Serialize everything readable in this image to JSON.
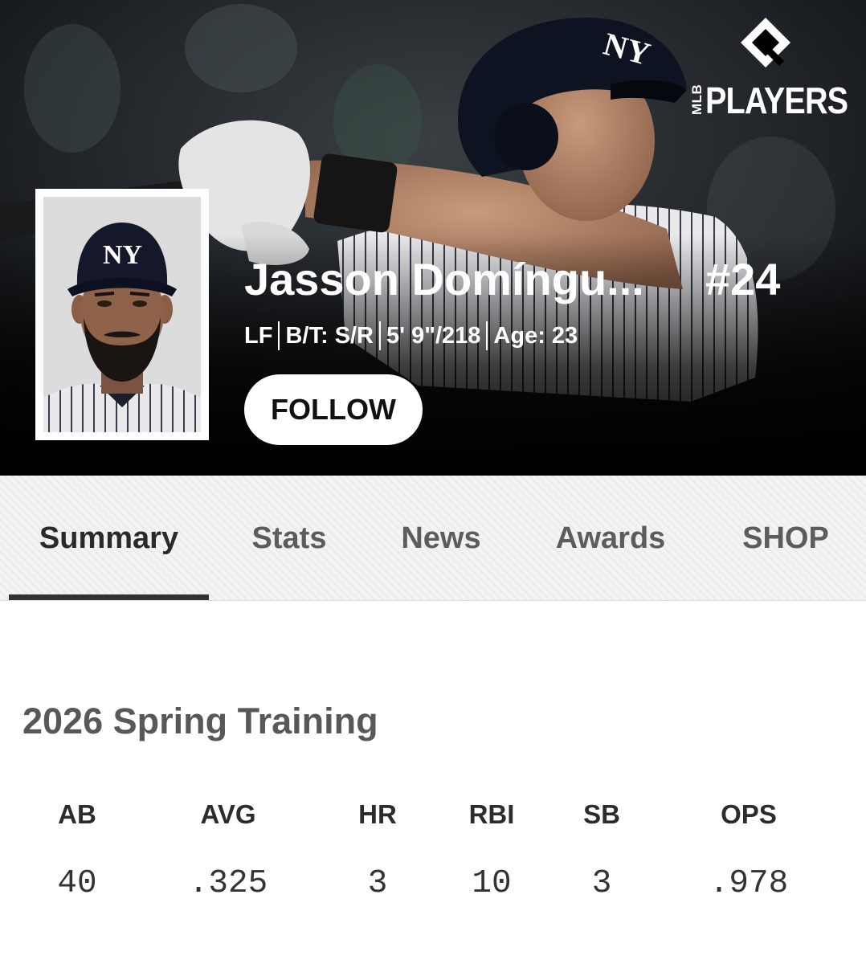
{
  "brand": {
    "small_text": "MLB",
    "wordmark": "PLAYERS"
  },
  "player": {
    "name": "Jasson Domíngu...",
    "number": "#24",
    "position": "LF",
    "bats_throws": "B/T: S/R",
    "height_weight": "5' 9\"/218",
    "age": "Age: 23",
    "headshot_cap_logo": "NY"
  },
  "actions": {
    "follow_label": "FOLLOW"
  },
  "tabs": [
    {
      "label": "Summary",
      "active": true
    },
    {
      "label": "Stats",
      "active": false
    },
    {
      "label": "News",
      "active": false
    },
    {
      "label": "Awards",
      "active": false
    },
    {
      "label": "SHOP",
      "active": false
    }
  ],
  "season": {
    "title": "2026 Spring Training",
    "stats": [
      {
        "label": "AB",
        "value": "40"
      },
      {
        "label": "AVG",
        "value": ".325"
      },
      {
        "label": "HR",
        "value": "3"
      },
      {
        "label": "RBI",
        "value": "10"
      },
      {
        "label": "SB",
        "value": "3"
      },
      {
        "label": "OPS",
        "value": ".978"
      }
    ]
  },
  "colors": {
    "hero_bg": "#000000",
    "tab_bg": "#f3f3f3",
    "tab_underline": "#333333",
    "title_gray": "#585858"
  }
}
